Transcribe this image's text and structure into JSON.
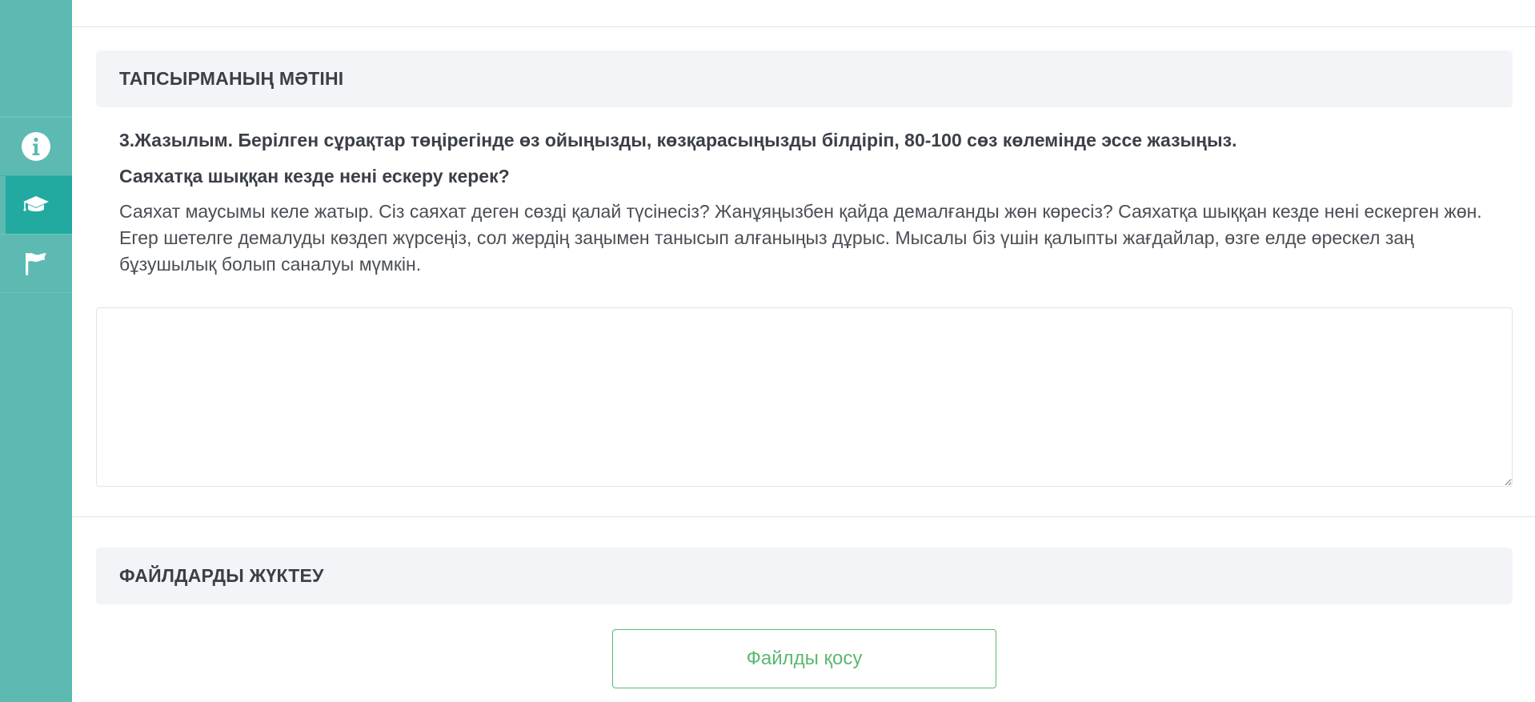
{
  "sidebar": {
    "items": [
      {
        "icon": "info-icon",
        "active": false
      },
      {
        "icon": "graduation-cap-icon",
        "active": true
      },
      {
        "icon": "flag-icon",
        "active": false
      }
    ]
  },
  "task_section": {
    "header": "ТАПСЫРМАНЫҢ МӘТІНІ",
    "title": "3.Жазылым. Берілген сұрақтар төңірегінде өз ойыңызды, көзқарасыңызды білдіріп, 80-100 сөз көлемінде эссе жазыңыз.",
    "question": "Саяхатқа шыққан кезде нені ескеру керек?",
    "body": "Саяхат маусымы келе жатыр. Сіз саяхат деген сөзді қалай түсінесіз? Жанұяңызбен қайда демалғанды жөн көресіз? Саяхатқа шыққан кезде нені ескерген жөн. Егер шетелге демалуды көздеп жүрсеңіз, сол жердің заңымен танысып алғаныңыз дұрыс. Мысалы біз үшін қалыпты жағдайлар, өзге елде өрескел заң бұзушылық болып саналуы мүмкін.",
    "answer_value": ""
  },
  "upload_section": {
    "header": "ФАЙЛДАРДЫ ЖҮКТЕУ",
    "button_label": "Файлды қосу"
  },
  "colors": {
    "sidebar_bg": "#5cbab3",
    "sidebar_active": "#22aaa0",
    "header_bg": "#f3f4f7",
    "upload_accent": "#5cb870"
  }
}
